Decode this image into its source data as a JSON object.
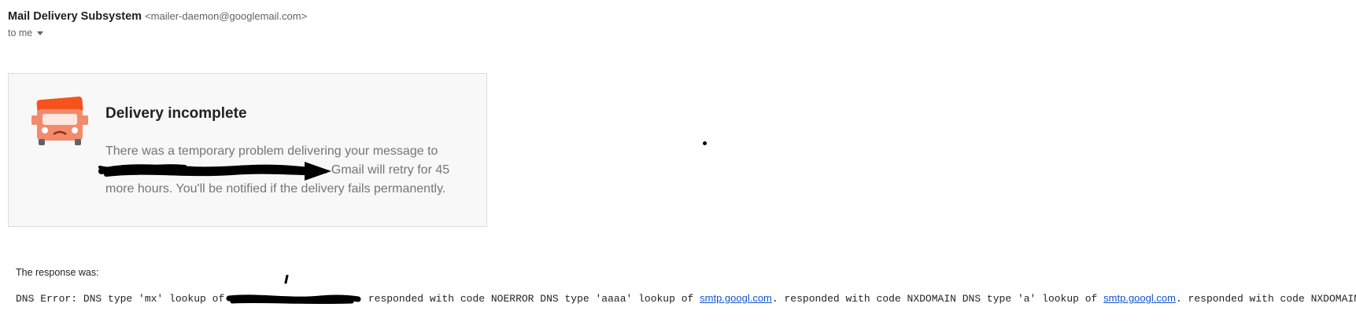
{
  "header": {
    "sender_name": "Mail Delivery Subsystem",
    "sender_email": "<mailer-daemon@googlemail.com>",
    "recipient": "to me"
  },
  "card": {
    "title": "Delivery incomplete",
    "line1": "There was a temporary problem delivering your message to",
    "line2_suffix": ". Gmail will retry for 45",
    "line3": "more hours. You'll be notified if the delivery fails permanently.",
    "icon": "delivery-truck-sad-icon",
    "icon_color": "#f5521e"
  },
  "response": {
    "label": "The response was:",
    "text1": "DNS Error: DNS type 'mx' lookup of ",
    "text2": " responded with code NOERROR DNS type 'aaaa' lookup of ",
    "link1": "smtp.googl.com",
    "text3": ". responded with code NXDOMAIN DNS type 'a' lookup of ",
    "link2": "smtp.googl.com",
    "text4": ". responded with code NXDOMAIN",
    "link_color": "#1155cc"
  }
}
